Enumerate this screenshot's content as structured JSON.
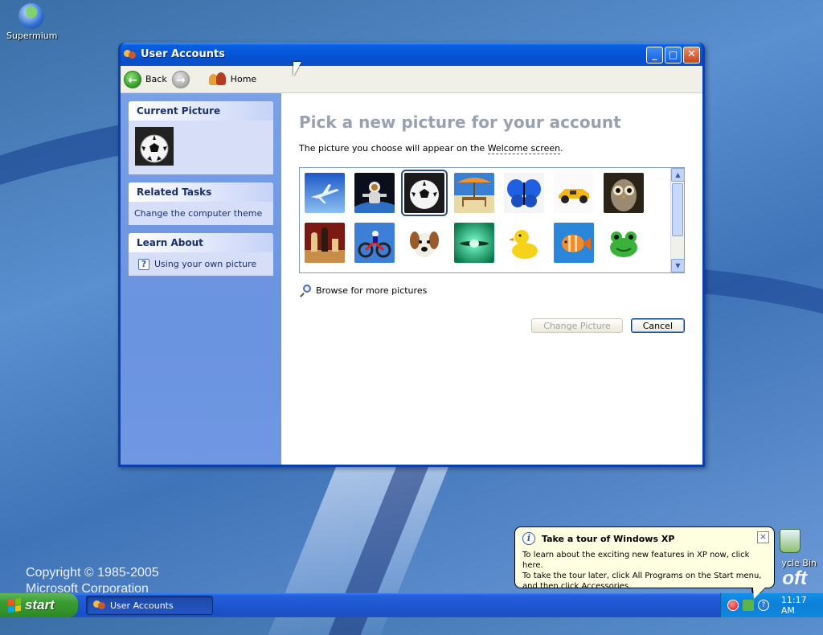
{
  "desktop": {
    "icons": [
      {
        "label": "Supermium",
        "icon": "supermium-globe-icon"
      }
    ],
    "recycle_bin_label": "ycle Bin",
    "brand_fragment": "oft",
    "copyright_line1": "Copyright © 1985-2005",
    "copyright_line2": "Microsoft Corporation"
  },
  "window": {
    "title": "User Accounts",
    "controls": {
      "minimize": "_",
      "maximize": "□",
      "close": "✕"
    },
    "toolbar": {
      "back": "Back",
      "home": "Home"
    }
  },
  "sidebar": {
    "current_picture": {
      "title": "Current Picture",
      "picture": "soccer-ball"
    },
    "related_tasks": {
      "title": "Related Tasks",
      "items": [
        "Change the computer theme"
      ]
    },
    "learn_about": {
      "title": "Learn About",
      "items": [
        "Using your own picture"
      ]
    }
  },
  "main": {
    "heading": "Pick a new picture for your account",
    "description_before": "The picture you choose will appear on the ",
    "description_link": "Welcome screen",
    "description_after": ".",
    "pictures": [
      [
        "airplane",
        "astronaut",
        "soccer-ball",
        "beach-chair",
        "butterfly",
        "race-car",
        "owl"
      ],
      [
        "chess",
        "dirt-bike",
        "dog",
        "fish-tank",
        "rubber-duck",
        "goldfish",
        "frog"
      ]
    ],
    "selected_picture": "soccer-ball",
    "browse_link": "Browse for more pictures",
    "buttons": {
      "change": "Change Picture",
      "cancel": "Cancel"
    }
  },
  "taskbar": {
    "start_label": "start",
    "tasks": [
      {
        "label": "User Accounts"
      }
    ],
    "clock": "11:17 AM"
  },
  "balloon": {
    "title": "Take a tour of Windows XP",
    "line1": "To learn about the exciting new features in XP now, click here.",
    "line2": "To take the tour later, click All Programs on the Start menu,",
    "line3": "and then click Accessories."
  }
}
